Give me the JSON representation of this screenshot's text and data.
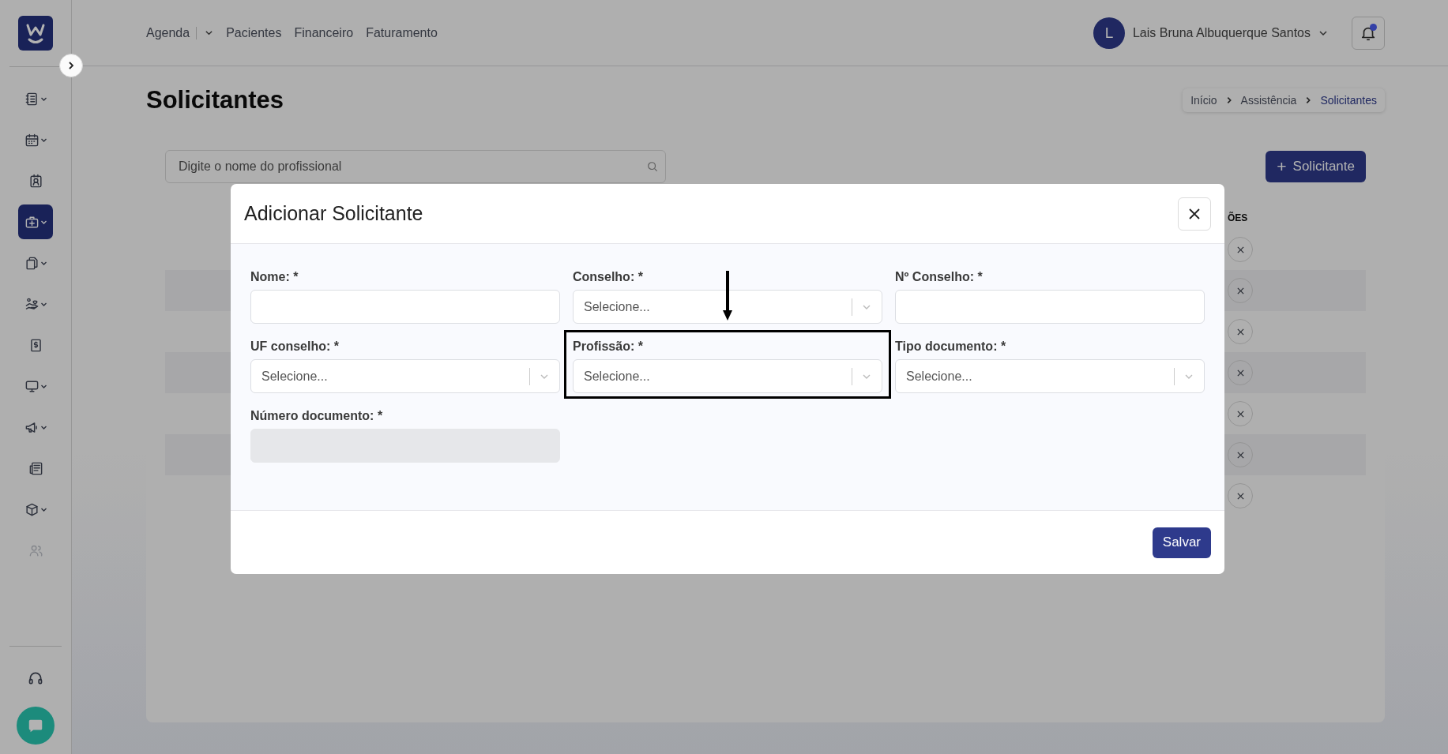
{
  "sidebar": {
    "items": [
      {
        "selected": false,
        "has_submenu": true,
        "disabled": false
      },
      {
        "selected": false,
        "has_submenu": true,
        "disabled": false
      },
      {
        "selected": false,
        "has_submenu": false,
        "disabled": false
      },
      {
        "selected": true,
        "has_submenu": true,
        "disabled": false
      },
      {
        "selected": false,
        "has_submenu": true,
        "disabled": false
      },
      {
        "selected": false,
        "has_submenu": true,
        "disabled": false
      },
      {
        "selected": false,
        "has_submenu": false,
        "disabled": false
      },
      {
        "selected": false,
        "has_submenu": true,
        "disabled": false
      },
      {
        "selected": false,
        "has_submenu": true,
        "disabled": false
      },
      {
        "selected": false,
        "has_submenu": false,
        "disabled": false
      },
      {
        "selected": false,
        "has_submenu": true,
        "disabled": false
      },
      {
        "selected": false,
        "has_submenu": false,
        "disabled": true
      }
    ]
  },
  "nav": [
    {
      "label": "Agenda",
      "dropdown": true
    },
    {
      "label": "Pacientes",
      "dropdown": false
    },
    {
      "label": "Financeiro",
      "dropdown": false
    },
    {
      "label": "Faturamento",
      "dropdown": false
    }
  ],
  "user": {
    "initial": "L",
    "name": "Lais Bruna Albuquerque Santos",
    "notification": true
  },
  "page_title": "Solicitantes",
  "breadcrumb": [
    {
      "label": "Início",
      "selected": false
    },
    {
      "label": "Assistência",
      "selected": false
    },
    {
      "label": "Solicitantes",
      "selected": true
    }
  ],
  "search": {
    "placeholder": "Digite o nome do profissional"
  },
  "add_button": {
    "icon": "+",
    "label": "Solicitante"
  },
  "table": {
    "header": "ÕES",
    "rows": [
      {
        "striped": false
      },
      {
        "striped": true
      },
      {
        "striped": false
      },
      {
        "striped": true
      },
      {
        "striped": false
      },
      {
        "striped": true
      },
      {
        "striped": false
      }
    ]
  },
  "modal": {
    "title": "Adicionar Solicitante",
    "fields": [
      {
        "label": "Nome: *",
        "kind": "text",
        "disabled": false,
        "highlighted": false,
        "pointer": false
      },
      {
        "label": "Conselho: *",
        "kind": "select",
        "placeholder": "Selecione...",
        "disabled": false,
        "highlighted": false,
        "pointer": false
      },
      {
        "label": "Nº Conselho: *",
        "kind": "text",
        "disabled": false,
        "highlighted": false,
        "pointer": false
      },
      {
        "label": "UF conselho: *",
        "kind": "select",
        "placeholder": "Selecione...",
        "disabled": false,
        "highlighted": false,
        "pointer": false
      },
      {
        "label": "Profissão: *",
        "kind": "select",
        "placeholder": "Selecione...",
        "disabled": false,
        "highlighted": true,
        "pointer": true
      },
      {
        "label": "Tipo documento: *",
        "kind": "select",
        "placeholder": "Selecione...",
        "disabled": false,
        "highlighted": false,
        "pointer": false
      },
      {
        "label": "Número documento: *",
        "kind": "text",
        "disabled": true,
        "highlighted": false,
        "pointer": false
      }
    ],
    "save_button": "Salvar"
  }
}
